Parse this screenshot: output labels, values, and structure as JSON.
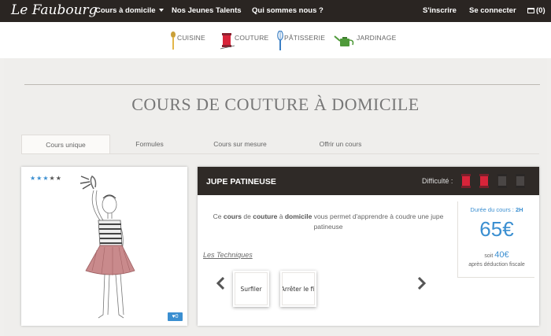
{
  "brand": {
    "logo_text": "Le Faubourg"
  },
  "topnav": {
    "items": [
      {
        "label": "Cours à domicile",
        "dropdown": true
      },
      {
        "label": "Nos Jeunes Talents"
      },
      {
        "label": "Qui sommes nous ?"
      }
    ],
    "signup": "S'inscrire",
    "login": "Se connecter",
    "cart": "(0)"
  },
  "categories": [
    {
      "label": "CUISINE",
      "icon": "spoon-icon"
    },
    {
      "label": "COUTURE",
      "icon": "spool-icon"
    },
    {
      "label": "PÂTISSERIE",
      "icon": "whisk-icon"
    },
    {
      "label": "JARDINAGE",
      "icon": "watering-can-icon"
    }
  ],
  "page": {
    "title": "COURS DE COUTURE À DOMICILE"
  },
  "tabs": [
    {
      "label": "Cours unique",
      "active": true
    },
    {
      "label": "Formules"
    },
    {
      "label": "Cours sur mesure"
    },
    {
      "label": "Offrir un cours"
    }
  ],
  "product": {
    "rating": 3,
    "rating_max": 5,
    "favorites": "0",
    "name": "JUPE PATINEUSE",
    "difficulty_label": "Difficulté :",
    "difficulty": 2,
    "difficulty_max": 4,
    "description": {
      "p1": "Ce ",
      "b1": "cours",
      "p2": " de ",
      "b2": "couture",
      "p3": " à ",
      "b3": "domicile",
      "p4": " vous permet d'apprendre à coudre une jupe patineuse"
    },
    "duration_label": "Durée du cours :",
    "duration": "2H",
    "price": "65€",
    "soit_label": "soit",
    "net_price": "40€",
    "deduction": "après déduction fiscale",
    "techniques_label": "Les Techniques",
    "techniques": [
      "Surfiler",
      "Arrêter le fil"
    ]
  },
  "colors": {
    "topbar": "#2a2522",
    "accent_blue": "#3b8fd1",
    "spool_active": "#d8243a",
    "spool_inactive": "#4a4645"
  }
}
